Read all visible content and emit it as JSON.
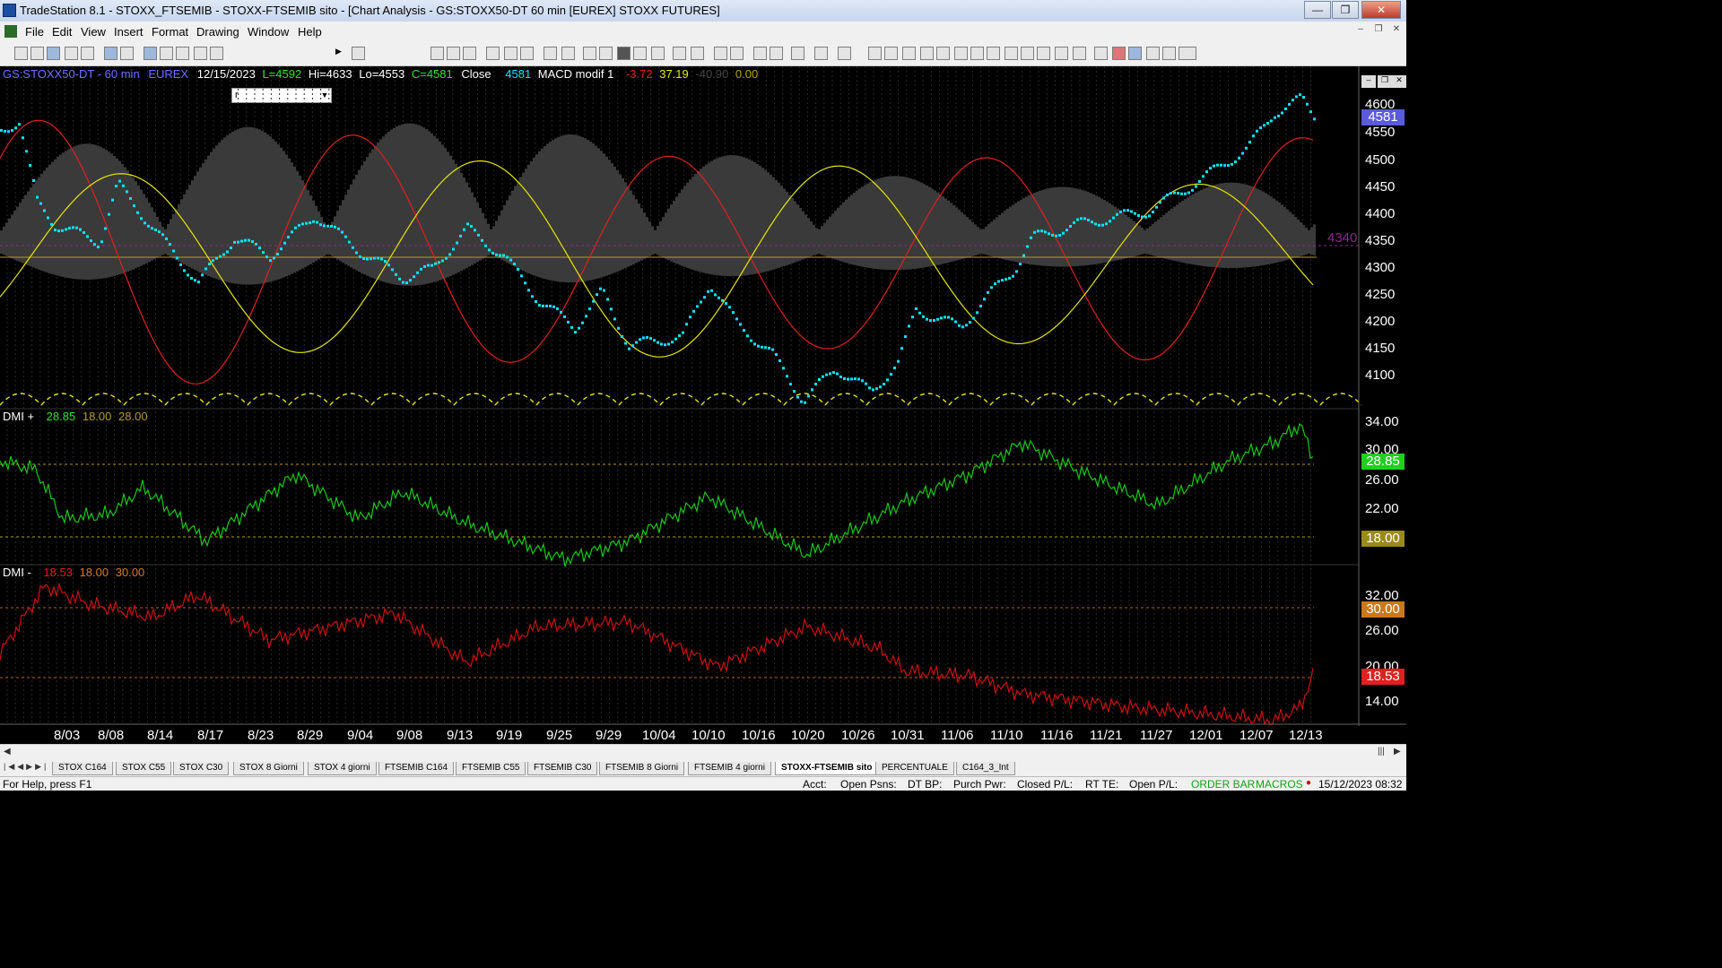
{
  "window": {
    "title": "TradeStation 8.1 - STOXX_FTSEMIB - STOXX-FTSEMIB sito - [Chart Analysis - GS:STOXX50-DT  60 min  [EUREX] STOXX FUTURES]",
    "minimize": "—",
    "restore": "❐",
    "close": "✕"
  },
  "menu": [
    "File",
    "Edit",
    "View",
    "Insert",
    "Format",
    "Drawing",
    "Window",
    "Help"
  ],
  "toolbar": {
    "symbol_input": "r"
  },
  "chart": {
    "header": {
      "symbol": "GS:STOXX50-DT - 60 min",
      "exchange": "EUREX",
      "date": "12/15/2023",
      "last": "L=4592",
      "high": "Hi=4633",
      "low": "Lo=4553",
      "close_val": "C=4581",
      "close_label": "Close",
      "close_num": "4581",
      "indicator": "MACD modif 1",
      "v1": "-3.72",
      "v2": "37.19",
      "v3": "-40.90",
      "v4": "0.00"
    },
    "dmi_plus": {
      "label": "DMI +",
      "v1": "28.85",
      "v2": "18.00",
      "v3": "28.00"
    },
    "dmi_minus": {
      "label": "DMI -",
      "v1": "18.53",
      "v2": "18.00",
      "v3": "30.00"
    },
    "price_axis": [
      "4600",
      "4550",
      "4500",
      "4450",
      "4400",
      "4350",
      "4300",
      "4250",
      "4200",
      "4150",
      "4100"
    ],
    "price_current": "4581",
    "price_marker": "4340",
    "dmi_plus_axis": [
      "34.00",
      "30.00",
      "26.00",
      "22.00"
    ],
    "dmi_plus_boxes": [
      "28.85",
      "18.00"
    ],
    "dmi_minus_axis": [
      "32.00",
      "26.00",
      "20.00",
      "14.00"
    ],
    "dmi_minus_boxes": [
      "30.00",
      "18.53"
    ],
    "dates": [
      "8/03",
      "8/08",
      "8/14",
      "8/17",
      "8/23",
      "8/29",
      "9/04",
      "9/08",
      "9/13",
      "9/19",
      "9/25",
      "9/29",
      "10/04",
      "10/10",
      "10/16",
      "10/20",
      "10/26",
      "10/31",
      "11/06",
      "11/10",
      "11/16",
      "11/21",
      "11/27",
      "12/01",
      "12/07",
      "12/13"
    ]
  },
  "colors": {
    "price": "#00e5ff",
    "red_line": "#e02020",
    "yellow_line": "#e6e600",
    "cloud": "#3a3a3a",
    "dmi_plus": "#16c816",
    "dmi_minus": "#cc1010"
  },
  "tabs": [
    "STOX C164",
    "STOX C55",
    "STOX  C30",
    "STOX  8 Giorni",
    "STOX 4 giorni",
    "FTSEMIB C164",
    "FTSEMIB C55",
    "FTSEMIB C30",
    "FTSEMIB  8 Giorni",
    "FTSEMIB  4 giorni",
    "STOXX-FTSEMIB sito",
    "PERCENTUALE",
    "C164_3_Int"
  ],
  "active_tab": "STOXX-FTSEMIB sito",
  "status": {
    "help": "For Help, press F1",
    "acct": "Acct:",
    "open_psns": "Open Psns:",
    "dt_bp": "DT BP:",
    "purch_pwr": "Purch Pwr:",
    "closed_pl": "Closed P/L:",
    "rt_te": "RT TE:",
    "open_pl": "Open P/L:",
    "order_bar": "ORDER BAR",
    "macros": "MACROS",
    "datetime": "15/12/2023 08:32"
  }
}
